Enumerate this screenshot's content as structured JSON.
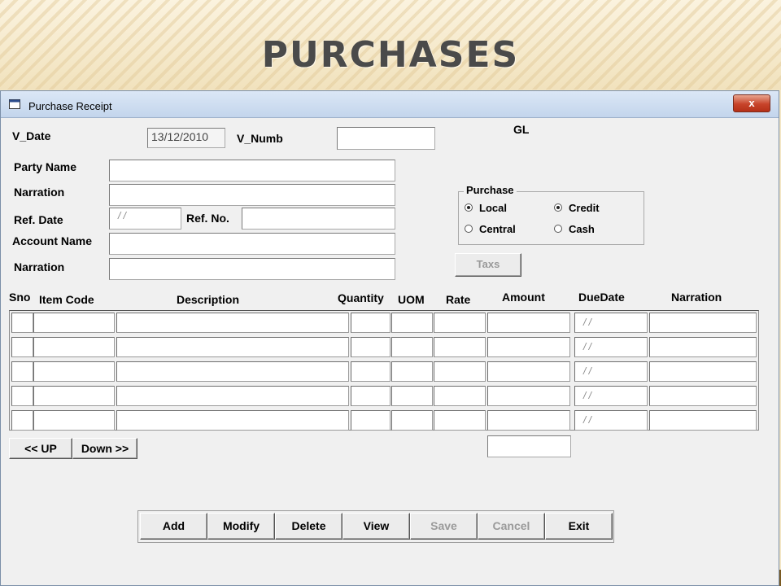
{
  "slide": {
    "title": "PURCHASES"
  },
  "window": {
    "title": "Purchase Receipt",
    "close_label": "x"
  },
  "header": {
    "v_date_label": "V_Date",
    "v_date_value": "13/12/2010",
    "v_numb_label": "V_Numb",
    "v_numb_value": "",
    "gl_label": "GL"
  },
  "fields": {
    "party_name_label": "Party Name",
    "narration_label": "Narration",
    "ref_date_label": "Ref. Date",
    "ref_date_value": "/ /",
    "ref_no_label": "Ref. No.",
    "account_name_label": "Account Name",
    "narration2_label": "Narration"
  },
  "purchase_group": {
    "title": "Purchase",
    "options": [
      {
        "label": "Local",
        "selected": true
      },
      {
        "label": "Credit",
        "selected": true
      },
      {
        "label": "Central",
        "selected": false
      },
      {
        "label": "Cash",
        "selected": false
      }
    ]
  },
  "taxes_button": "Taxs",
  "grid": {
    "columns": [
      "Sno",
      "Item Code",
      "Description",
      "Quantity",
      "UOM",
      "Rate",
      "Amount",
      "DueDate",
      "Narration"
    ],
    "due_placeholder": "/ /",
    "row_count": 5
  },
  "nav": {
    "up_label": "<< UP",
    "down_label": "Down >>"
  },
  "actions": {
    "add": "Add",
    "modify": "Modify",
    "delete": "Delete",
    "view": "View",
    "save": "Save",
    "cancel": "Cancel",
    "exit": "Exit"
  }
}
